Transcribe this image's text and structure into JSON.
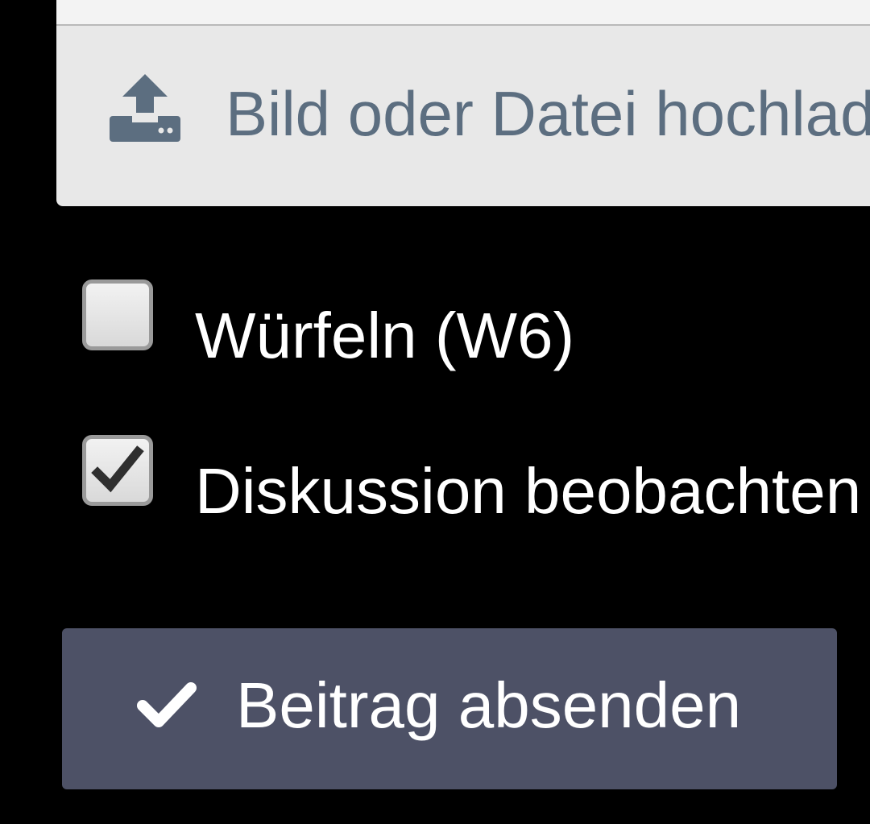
{
  "editor": {
    "upload_label": "Bild oder Datei hochlad",
    "upload_icon": "upload-icon"
  },
  "options": {
    "roll_dice": {
      "label": "Würfeln (W6)",
      "checked": false
    },
    "watch_discussion": {
      "label": "Diskussion beobachten",
      "checked": true
    }
  },
  "submit": {
    "label": "Beitrag absenden",
    "icon": "checkmark-icon"
  },
  "colors": {
    "background": "#000000",
    "panel": "#e8e8e8",
    "upload_text": "#5c6e80",
    "button": "#4d5166",
    "text": "#ffffff"
  }
}
